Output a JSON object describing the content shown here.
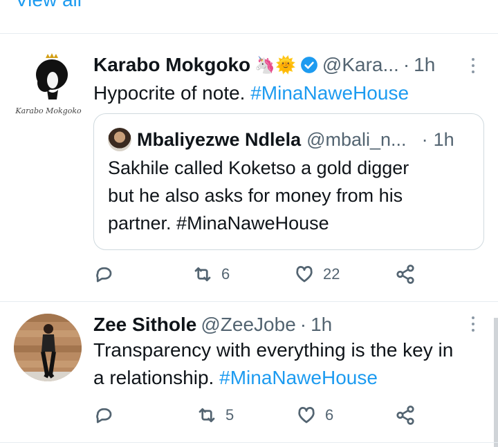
{
  "top": {
    "view_all_label": "View all"
  },
  "tweets": [
    {
      "author_name": "Karabo Mokgoko",
      "author_emojis": "🦄🌞",
      "author_handle": "@Kara...",
      "separator": "·",
      "time": "1h",
      "text": "Hypocrite of note.",
      "hashtag": "#MinaNaweHouse",
      "avatar_caption": "Karabo Mokgoko",
      "quote": {
        "author_name": "Mbaliyezwe Ndlela",
        "author_handle": "@mbali_n...",
        "separator": "·",
        "time": "1h",
        "text_lines": [
          "Sakhile called Koketso a gold digger",
          "but he also asks for money from his",
          "partner. #MinaNaweHouse"
        ]
      },
      "actions": {
        "retweets": "6",
        "likes": "22"
      }
    },
    {
      "author_name": "Zee Sithole",
      "author_handle": "@ZeeJobe",
      "separator": "·",
      "time": "1h",
      "text": "Transparency with everything is the key in",
      "text_line2": "a relationship.",
      "hashtag": "#MinaNaweHouse",
      "actions": {
        "retweets": "5",
        "likes": "6"
      }
    }
  ],
  "colors": {
    "link": "#1d9bf0",
    "muted": "#536471",
    "divider": "#e6ecf0",
    "verified": "#1d9bf0"
  },
  "icons": [
    "reply-icon",
    "retweet-icon",
    "like-icon",
    "share-icon",
    "verified-icon",
    "more-icon"
  ]
}
